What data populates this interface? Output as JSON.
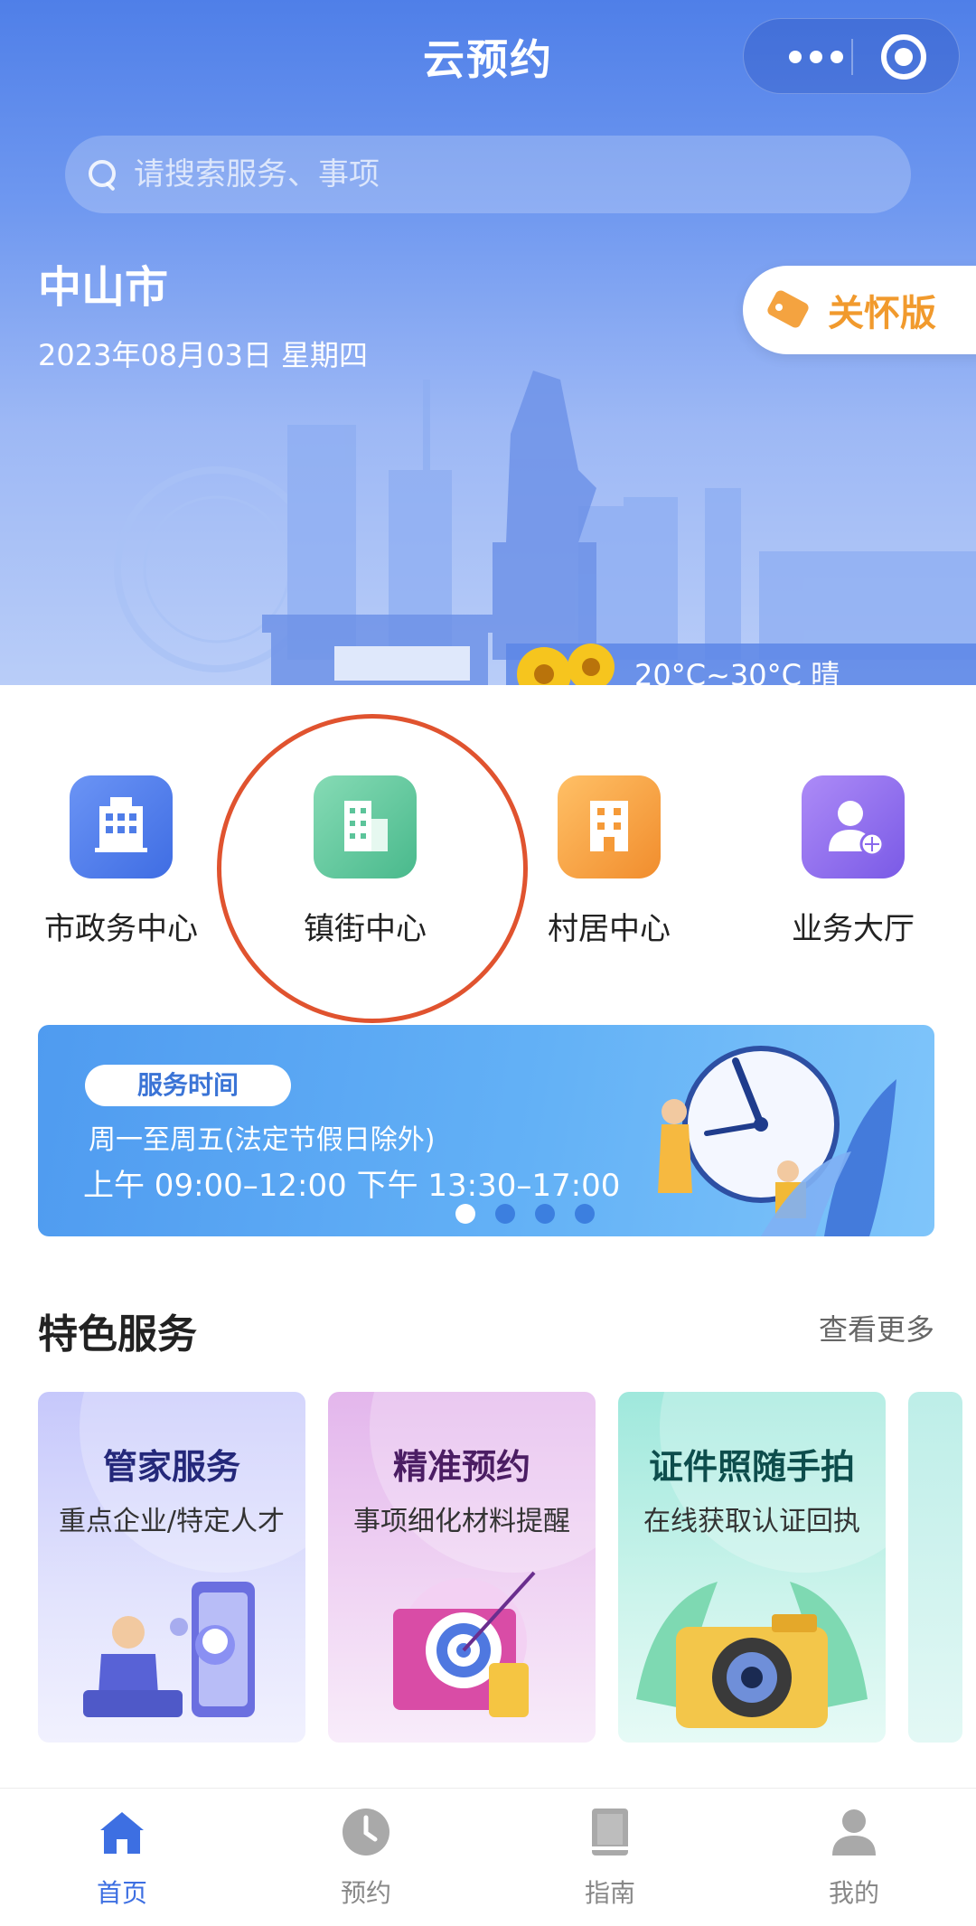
{
  "header": {
    "title": "云预约",
    "menu_icon": "more-dots-icon",
    "close_icon": "target-icon"
  },
  "search": {
    "placeholder": "请搜索服务、事项"
  },
  "location": {
    "city": "中山市",
    "date": "2023年08月03日  星期四"
  },
  "care_mode": {
    "label": "关怀版"
  },
  "weather": {
    "text": "20°C~30°C 晴"
  },
  "entries": [
    {
      "label": "市政务中心",
      "icon": "office-building-icon",
      "color": "#4f7de8"
    },
    {
      "label": "镇街中心",
      "icon": "building-icon",
      "color": "#5cc49a"
    },
    {
      "label": "村居中心",
      "icon": "house-icon",
      "color": "#f59a38"
    },
    {
      "label": "业务大厅",
      "icon": "user-globe-icon",
      "color": "#8a69ec"
    }
  ],
  "banner": {
    "pill": "服务时间",
    "line1": "周一至周五(法定节假日除外)",
    "line2": "上午 09:00–12:00  下午 13:30–17:00",
    "active_dot": 1,
    "dots": 4
  },
  "special": {
    "title": "特色服务",
    "more": "查看更多",
    "cards": [
      {
        "title": "管家服务",
        "subtitle": "重点企业/特定人才"
      },
      {
        "title": "精准预约",
        "subtitle": "事项细化材料提醒"
      },
      {
        "title": "证件照随手拍",
        "subtitle": "在线获取认证回执"
      }
    ]
  },
  "tabbar": {
    "tabs": [
      {
        "label": "首页",
        "icon": "home-icon",
        "active": true
      },
      {
        "label": "预约",
        "icon": "clock-icon",
        "active": false
      },
      {
        "label": "指南",
        "icon": "book-icon",
        "active": false
      },
      {
        "label": "我的",
        "icon": "user-icon",
        "active": false
      }
    ],
    "active_color": "#3d6fe2"
  }
}
